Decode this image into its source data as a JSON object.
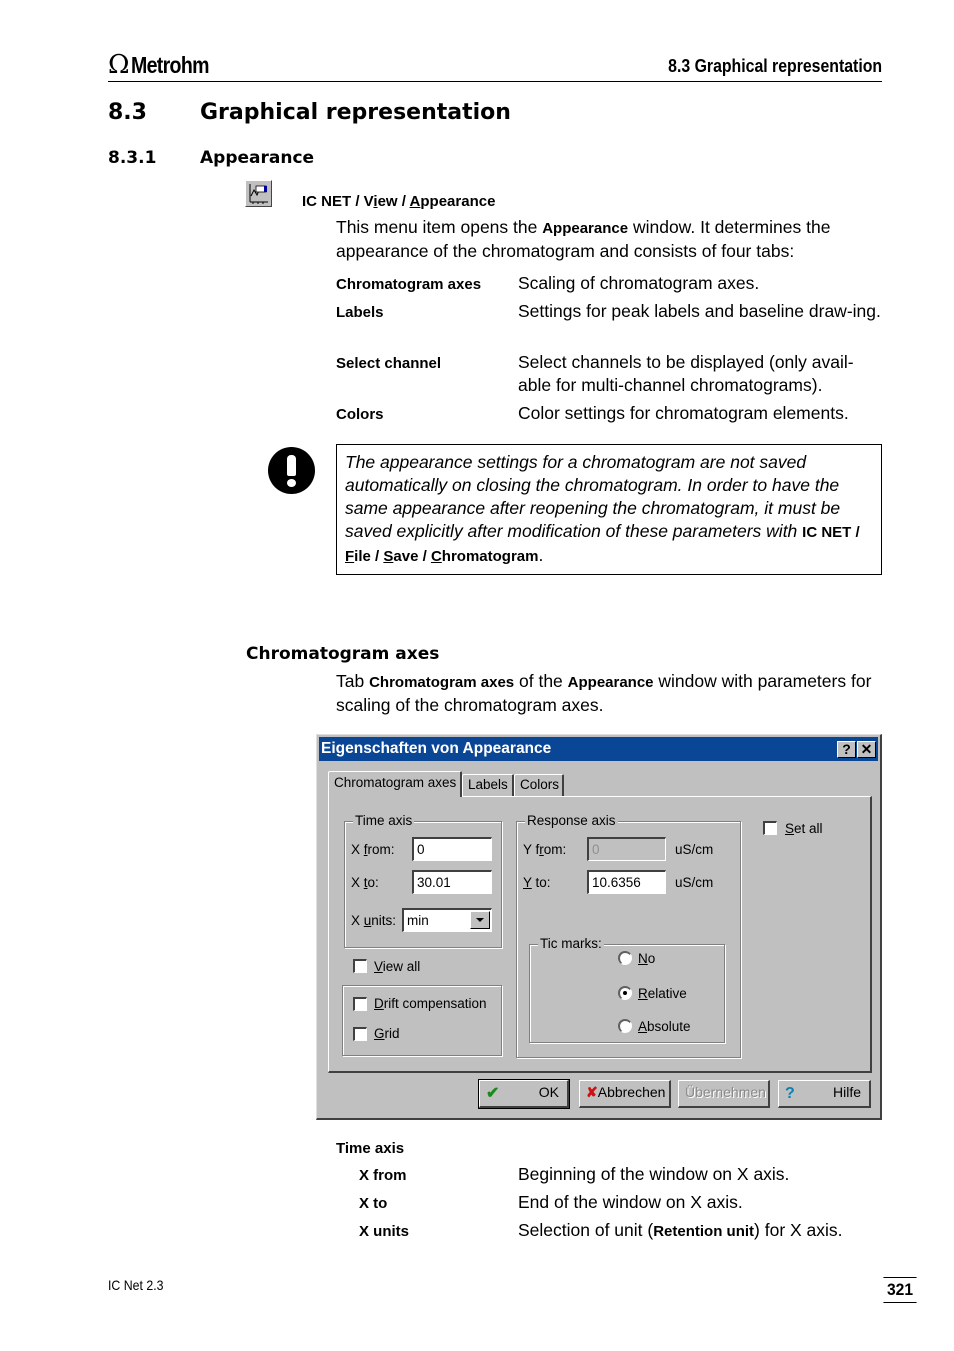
{
  "header": {
    "logo_text": "Metrohm",
    "logo_icon": "omega-icon",
    "section_ref": "8.3  Graphical representation"
  },
  "section": {
    "number": "8.3",
    "title": "Graphical representation"
  },
  "subsection": {
    "number": "8.3.1",
    "title": "Appearance"
  },
  "menu_path": {
    "icon": "appearance-chart-icon",
    "part1": "IC NET / ",
    "view_pre": "V",
    "view_ul": "i",
    "view_post": "ew",
    "sep": " / ",
    "app_ul": "A",
    "app_post": "ppearance"
  },
  "intro": {
    "pre": "This menu item opens the ",
    "bold": "Appearance",
    "post": " window. It determines the appearance of the chromatogram and consists of four tabs:"
  },
  "tabs_list": [
    {
      "term": "Chromatogram axes",
      "desc": "Scaling of chromatogram axes."
    },
    {
      "term": "Labels",
      "desc": "Settings for peak labels and baseline draw-ing."
    },
    {
      "term": "Select channel",
      "desc": "Select channels to be displayed (only avail-able for multi-channel chromatograms)."
    },
    {
      "term": "Colors",
      "desc": "Color settings for chromatogram elements."
    }
  ],
  "note": {
    "icon": "exclamation-icon",
    "text": "The appearance settings for a chromatogram are not saved automatically on closing the chromatogram. In order to have the same appearance after reopening the chromatogram, it must be saved explicitly after modification of these parameters with ",
    "path_a": "IC NET / ",
    "file_ul": "F",
    "file_post": "ile",
    "sep": " / ",
    "save_ul": "S",
    "save_post": "ave",
    "chrom_ul": "C",
    "chrom_post": "hromatogram",
    "end": "."
  },
  "chromatogram_axes": {
    "heading": "Chromatogram axes",
    "desc_pre": "Tab ",
    "desc_b1": "Chromatogram axes",
    "desc_mid": " of the ",
    "desc_b2": "Appearance",
    "desc_post": " window with parameters for scaling of the chromatogram axes."
  },
  "dialog": {
    "title": "Eigenschaften von Appearance",
    "help_btn": "?",
    "close_btn": "✕",
    "tabs": [
      "Chromatogram axes",
      "Labels",
      "Colors"
    ],
    "active_tab": "Chromatogram axes",
    "time_axis": {
      "label": "Time axis",
      "x_from_label": "X from:",
      "x_from_value": "0",
      "x_to_label": "X to:",
      "x_to_value": "30.01",
      "x_units_label": "X units:",
      "x_units_value": "min"
    },
    "view_all": {
      "label": "View all",
      "checked": false
    },
    "drift_compensation": {
      "label": "Drift compensation",
      "checked": false
    },
    "grid": {
      "label": "Grid",
      "checked": false
    },
    "response_axis": {
      "label": "Response axis",
      "y_from_label": "Y from:",
      "y_from_value": "0",
      "y_from_unit": "uS/cm",
      "y_to_label": "Y to:",
      "y_to_value": "10.6356",
      "y_to_unit": "uS/cm"
    },
    "tic_marks": {
      "label": "Tic marks:",
      "options": [
        "No",
        "Relative",
        "Absolute"
      ],
      "selected": "Relative"
    },
    "set_all": {
      "label": "Set all",
      "checked": false
    },
    "buttons": {
      "ok": "OK",
      "cancel": "Abbrechen",
      "apply": "Übernehmen",
      "help": "Hilfe"
    }
  },
  "time_axis_params": {
    "heading": "Time axis",
    "items": [
      {
        "term": "X from",
        "desc": "Beginning of the window on X axis."
      },
      {
        "term": "X to",
        "desc": "End of the window on X axis."
      },
      {
        "term": "X units",
        "desc_pre": "Selection of unit (",
        "desc_b": "Retention unit",
        "desc_post": ") for X axis."
      }
    ]
  },
  "footer": {
    "product": "IC Net 2.3",
    "page": "321"
  }
}
